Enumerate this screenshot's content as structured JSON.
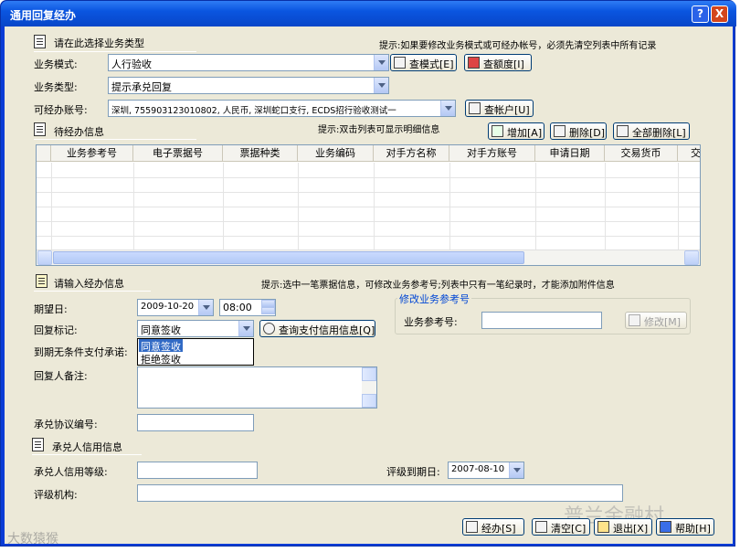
{
  "window": {
    "title": "通用回复经办",
    "help_btn": "?",
    "close_btn": "X"
  },
  "section_business": {
    "title": "请在此选择业务类型",
    "hint": "提示:如果要修改业务模式或可经办帐号，必须先清空列表中所有记录"
  },
  "fields": {
    "mode_label": "业务模式:",
    "mode_value": "人行验收",
    "view_mode_btn": "查模式[E]",
    "view_quota_btn": "查额度[I]",
    "type_label": "业务类型:",
    "type_value": "提示承兑回复",
    "account_label": "可经办账号:",
    "account_value": "深圳, 755903123010802, 人民币, 深圳蛇口支行, ECDS招行验收测试一",
    "view_account_btn": "查帐户[U]"
  },
  "section_pending": {
    "title": "待经办信息",
    "hint": "提示:双击列表可显示明细信息",
    "add_btn": "增加[A]",
    "delete_btn": "删除[D]",
    "delete_all_btn": "全部删除[L]"
  },
  "grid": {
    "columns": [
      "业务参考号",
      "电子票据号",
      "票据种类",
      "业务编码",
      "对手方名称",
      "对手方账号",
      "申请日期",
      "交易货币",
      "交"
    ],
    "rows": []
  },
  "section_input": {
    "title": "请输入经办信息",
    "hint": "提示:选中一笔票据信息，可修改业务参考号;列表中只有一笔纪录时，才能添加附件信息",
    "expect_date_label": "期望日:",
    "expect_date_value": "2009-10-20",
    "expect_time_value": "08:00",
    "reply_flag_label": "回复标记:",
    "reply_flag_value": "同意签收",
    "reply_options": [
      "同意签收",
      "拒绝签收"
    ],
    "query_credit_btn": "查询支付信用信息[Q]",
    "unconditional_label": "到期无条件支付承诺:",
    "remark_label": "回复人备注:",
    "agreement_label": "承兑协议编号:",
    "modify_group_title": "修改业务参考号",
    "ref_no_label": "业务参考号:",
    "modify_btn": "修改[M]"
  },
  "section_credit": {
    "title": "承兑人信用信息",
    "credit_level_label": "承兑人信用等级:",
    "rating_expire_label": "评级到期日:",
    "rating_expire_value": "2007-08-10",
    "rating_org_label": "评级机构:"
  },
  "footer": {
    "submit_btn": "经办[S]",
    "clear_btn": "清空[C]",
    "exit_btn": "退出[X]",
    "help_btn": "帮助[H]"
  },
  "watermarks": {
    "right": "普兰金融村",
    "left": "大数猿猴"
  }
}
